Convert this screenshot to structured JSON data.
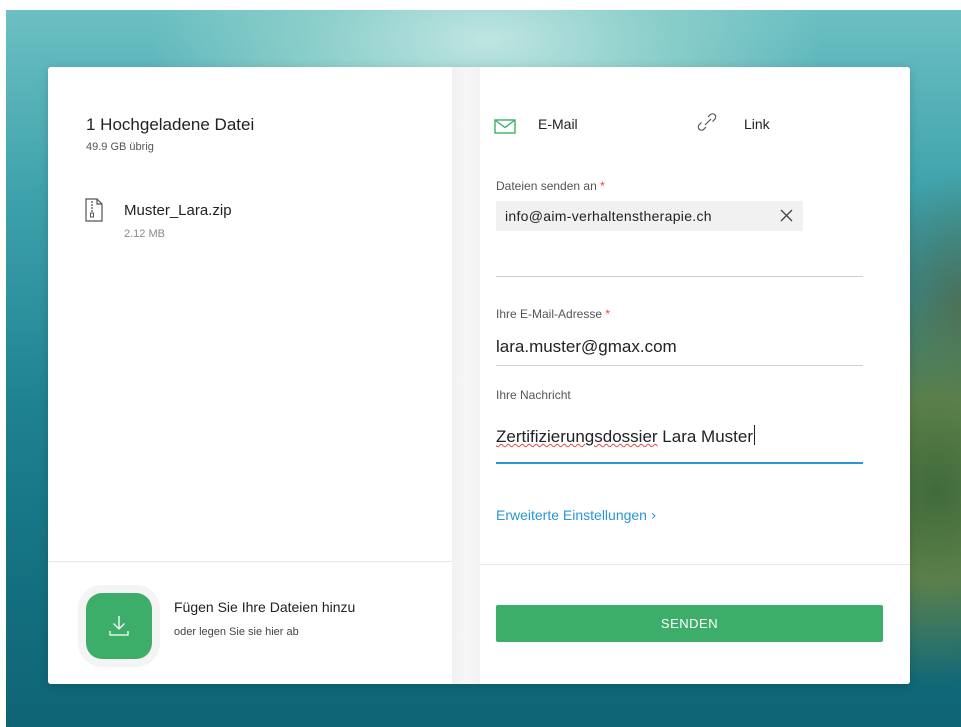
{
  "colors": {
    "accent_green": "#3dae6a",
    "link_blue": "#2b96d6",
    "required_red": "#e5483b"
  },
  "upload": {
    "title": "1 Hochgeladene Datei",
    "remaining": "49.9 GB übrig",
    "files": [
      {
        "name": "Muster_Lara.zip",
        "size": "2.12 MB",
        "icon": "zip-file-icon"
      }
    ],
    "add": {
      "title": "Fügen Sie Ihre Dateien hinzu",
      "subtitle": "oder legen Sie sie hier ab",
      "icon": "download-arrow-icon"
    }
  },
  "tabs": [
    {
      "label": "E-Mail",
      "icon": "envelope-icon",
      "active": true
    },
    {
      "label": "Link",
      "icon": "link-icon",
      "active": false
    }
  ],
  "form": {
    "recipients_label": "Dateien senden an",
    "required_mark": "*",
    "recipients": [
      "info@aim-verhaltenstherapie.ch"
    ],
    "sender_label": "Ihre E-Mail-Adresse",
    "sender_value": "lara.muster@gmax.com",
    "message_label": "Ihre Nachricht",
    "message_value_misspelled": "Zertifizierungsdossier",
    "message_value_rest": " Lara Muster",
    "advanced_label": "Erweiterte Einstellungen",
    "send_label": "SENDEN"
  }
}
